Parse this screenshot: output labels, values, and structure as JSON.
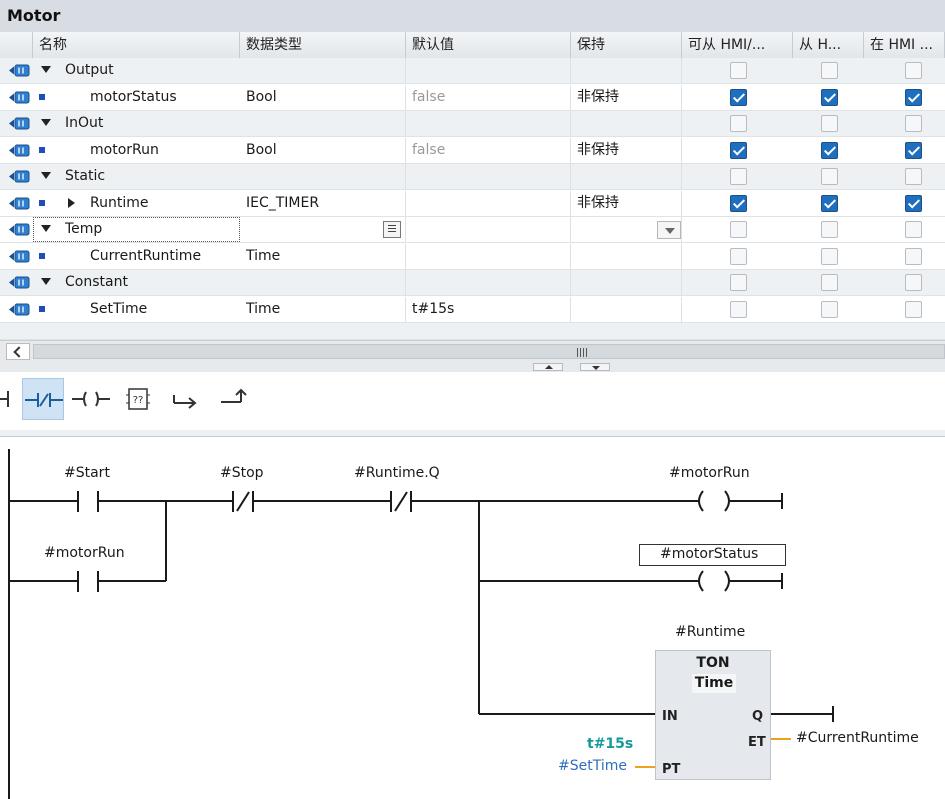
{
  "block_title": "Motor",
  "columns": [
    "名称",
    "数据类型",
    "默认值",
    "保持",
    "可从 HMI/...",
    "从 H...",
    "在 HMI ..."
  ],
  "rows": [
    {
      "kind": "section",
      "name": "Output",
      "type": "",
      "default": "",
      "retain": "",
      "hmi": [
        false,
        false,
        false
      ]
    },
    {
      "kind": "var",
      "name": "motorStatus",
      "type": "Bool",
      "default": "false",
      "retain": "非保持",
      "hmi": [
        true,
        true,
        true
      ]
    },
    {
      "kind": "section",
      "name": "InOut",
      "type": "",
      "default": "",
      "retain": "",
      "hmi": [
        false,
        false,
        false
      ]
    },
    {
      "kind": "var",
      "name": "motorRun",
      "type": "Bool",
      "default": "false",
      "retain": "非保持",
      "hmi": [
        true,
        true,
        true
      ]
    },
    {
      "kind": "section",
      "name": "Static",
      "type": "",
      "default": "",
      "retain": "",
      "hmi": [
        false,
        false,
        false
      ]
    },
    {
      "kind": "struct",
      "name": "Runtime",
      "type": "IEC_TIMER",
      "default": "",
      "retain": "非保持",
      "hmi": [
        true,
        true,
        true
      ]
    },
    {
      "kind": "section",
      "name": "Temp",
      "type": "",
      "default": "",
      "retain": "",
      "hmi": [
        false,
        false,
        false
      ]
    },
    {
      "kind": "var",
      "name": "CurrentRuntime",
      "type": "Time",
      "default": "",
      "retain": "",
      "hmi": [
        false,
        false,
        false
      ]
    },
    {
      "kind": "section",
      "name": "Constant",
      "type": "",
      "default": "",
      "retain": "",
      "hmi": [
        false,
        false,
        false
      ]
    },
    {
      "kind": "var",
      "name": "SetTime",
      "type": "Time",
      "default": "t#15s",
      "retain": "",
      "hmi": [
        false,
        false,
        false
      ]
    }
  ],
  "toolbar": {
    "items": [
      "contact-no-icon",
      "contact-nc-icon",
      "coil-icon",
      "empty-box-icon",
      "open-branch-icon",
      "close-branch-icon"
    ],
    "box_label": "??"
  },
  "ladder": {
    "contact_start": "#Start",
    "contact_stop": "#Stop",
    "contact_runtime_q": "#Runtime.Q",
    "contact_motorrun": "#motorRun",
    "coil_motorrun": "#motorRun",
    "coil_motorstatus": "#motorStatus",
    "coil_symbol": "( )",
    "timer_instance": "#Runtime",
    "timer_type": "TON",
    "timer_time": "Time",
    "pin_in": "IN",
    "pin_q": "Q",
    "pin_et": "ET",
    "pin_pt": "PT",
    "pt_const": "t#15s",
    "pt_var": "#SetTime",
    "et_var": "#CurrentRuntime"
  },
  "colors": {
    "teal": "#149a9a",
    "blue_text": "#2f6fba",
    "orange_wire": "#f0a020",
    "checkbox_on": "#1f6fbf"
  }
}
